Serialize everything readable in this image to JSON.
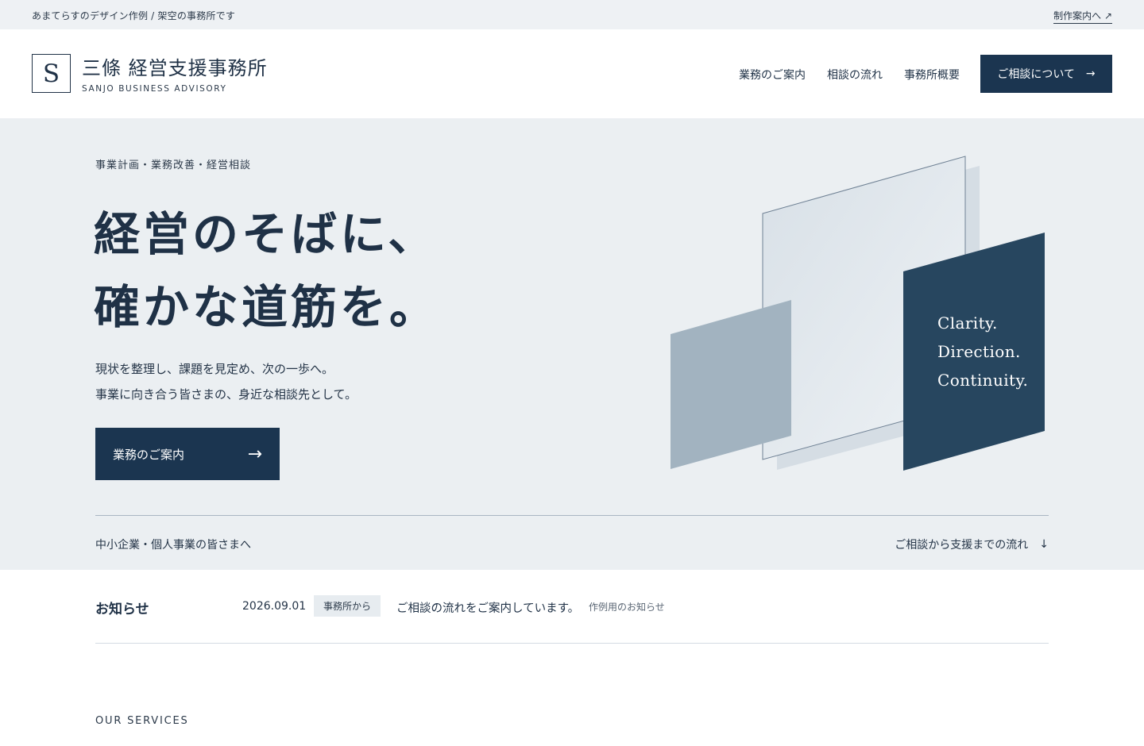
{
  "topbar": {
    "note": "あまてらすのデザイン作例 / 架空の事務所です",
    "project_link": "制作案内へ ↗"
  },
  "header": {
    "logo_mark": "S",
    "logo_name": "三條 経営支援事務所",
    "logo_sub": "SANJO BUSINESS ADVISORY",
    "nav": [
      "業務のご案内",
      "相談の流れ",
      "事務所概要"
    ],
    "cta": "ご相談について",
    "cta_arrow": "→"
  },
  "hero": {
    "eyebrow": "事業計画・業務改善・経営相談",
    "headline": [
      "経営のそばに、",
      "確かな道筋を。"
    ],
    "lead": [
      "現状を整理し、課題を見定め、次の一歩へ。",
      "事業に向き合う皆さまの、身近な相談先として。"
    ],
    "cta": "業務のご案内",
    "cta_arrow": "→",
    "tagline": [
      "Clarity.",
      "Direction.",
      "Continuity."
    ],
    "audience": "中小企業・個人事業の皆さまへ",
    "flow_link": "ご相談から支援までの流れ",
    "flow_arrow": "↓"
  },
  "news": {
    "title": "お知らせ",
    "date": "2026.09.01",
    "tag": "事務所から",
    "text": "ご相談の流れをご案内しています。",
    "note": "作例用のお知らせ"
  },
  "services": {
    "label": "OUR SERVICES"
  },
  "colors": {
    "navy": "#1b3550",
    "panel_navy": "#27465f",
    "hero_bg": "#ebeff2",
    "slate": "#a2b3c0"
  }
}
